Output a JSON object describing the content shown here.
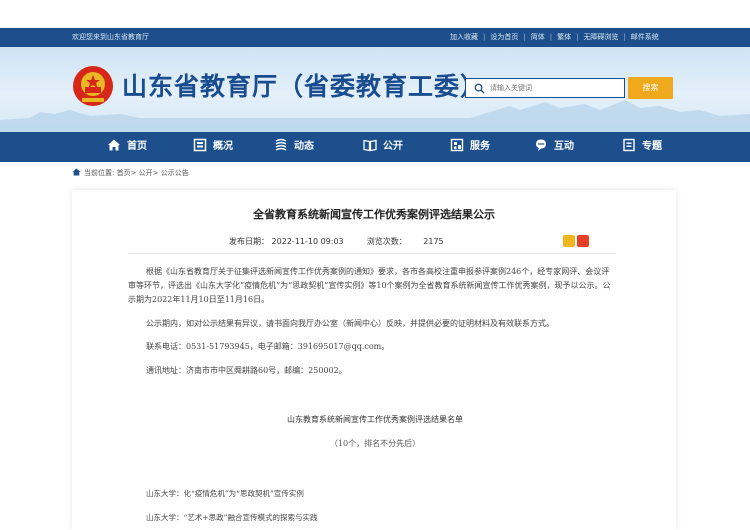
{
  "topbar": {
    "welcome": "欢迎您来到山东省教育厅",
    "links": [
      "加入收藏",
      "设为首页",
      "简体",
      "繁体",
      "无障碍浏览",
      "邮件系统"
    ],
    "separator": "|"
  },
  "header": {
    "site_title": "山东省教育厅（省委教育工委）",
    "search_placeholder": "请输入关键词",
    "search_button": "搜索"
  },
  "nav": {
    "items": [
      {
        "label": "首页",
        "icon": "home-icon"
      },
      {
        "label": "概况",
        "icon": "overview-icon"
      },
      {
        "label": "动态",
        "icon": "news-icon"
      },
      {
        "label": "公开",
        "icon": "book-icon"
      },
      {
        "label": "服务",
        "icon": "service-icon"
      },
      {
        "label": "互动",
        "icon": "chat-icon"
      },
      {
        "label": "专题",
        "icon": "topic-icon"
      }
    ]
  },
  "breadcrumb": "当前位置: 首页> 公开> 公示公告",
  "article": {
    "title": "全省教育系统新闻宣传工作优秀案例评选结果公示",
    "date_label": "发布日期：",
    "date": "2022-11-10 09:03",
    "views_label": "浏览次数：",
    "views": "2175",
    "paragraphs": [
      "根据《山东省教育厅关于征集评选新闻宣传工作优秀案例的通知》要求，各市各高校注重申报参评案例246个，经专家网评、会议评审等环节，评选出《山东大学化“疫情危机”为“思政契机”宣传实例》等10个案例为全省教育系统新闻宣传工作优秀案例，现予以公示。公示期为2022年11月10日至11月16日。",
      "公示期内，如对公示结果有异议，请书面向我厅办公室（新闻中心）反映，并提供必要的证明材料及有效联系方式。",
      "联系电话：0531-51793945，电子邮箱：391695017@qq.com。",
      "通讯地址：济南市市中区舜耕路60号，邮编：250002。"
    ],
    "list_title": "山东教育系统新闻宣传工作优秀案例评选结果名单",
    "list_note": "（10个，排名不分先后）",
    "items": [
      "山东大学：化“疫情危机”为“思政契机”宣传实例",
      "山东大学：“艺术+思政”融合宣传模式的探索与实践"
    ]
  },
  "colors": {
    "nav_blue": "#1c4f8c",
    "title_blue": "#1a4d8f",
    "search_orange": "#f0a81c"
  }
}
